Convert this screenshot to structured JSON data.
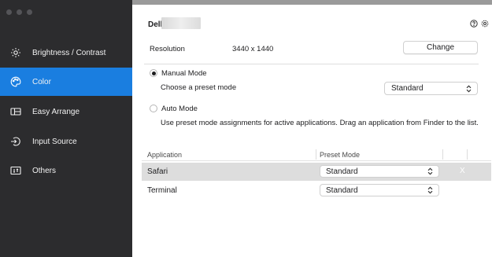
{
  "sidebar": {
    "items": [
      {
        "label": "Brightness / Contrast",
        "icon": "sun-icon"
      },
      {
        "label": "Color",
        "icon": "palette-icon",
        "active": true
      },
      {
        "label": "Easy Arrange",
        "icon": "layout-icon"
      },
      {
        "label": "Input Source",
        "icon": "input-source-icon"
      },
      {
        "label": "Others",
        "icon": "others-icon"
      }
    ]
  },
  "header": {
    "model_label": "Dell",
    "help_icon": "help-icon",
    "settings_icon": "gear-icon"
  },
  "resolution": {
    "label": "Resolution",
    "value": "3440 x 1440",
    "change_label": "Change"
  },
  "manual_mode": {
    "label": "Manual Mode",
    "selected": true,
    "hint": "Choose a preset mode",
    "preset_value": "Standard"
  },
  "auto_mode": {
    "label": "Auto Mode",
    "selected": false,
    "description": "Use preset mode assignments for active applications. Drag an application from Finder to the list."
  },
  "app_table": {
    "headers": {
      "application": "Application",
      "preset_mode": "Preset Mode"
    },
    "rows": [
      {
        "app": "Safari",
        "preset": "Standard",
        "selected": true,
        "remove_label": "X"
      },
      {
        "app": "Terminal",
        "preset": "Standard",
        "selected": false
      }
    ]
  },
  "colors": {
    "sidebar_bg": "#2c2c2e",
    "accent": "#1a7ee0",
    "selected_row": "#dddddd"
  }
}
